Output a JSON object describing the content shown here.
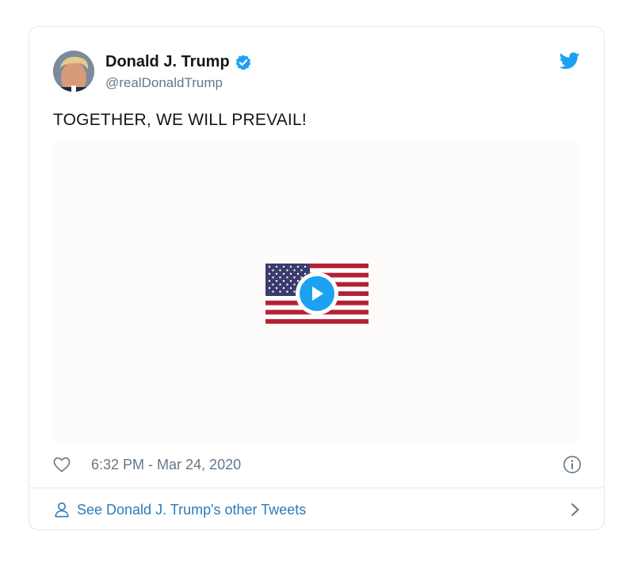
{
  "tweet": {
    "author_name": "Donald J. Trump",
    "handle": "@realDonaldTrump",
    "text": "TOGETHER, WE WILL PREVAIL!",
    "timestamp": "6:32 PM - Mar 24, 2020",
    "verified": true
  },
  "media": {
    "type": "video",
    "thumbnail": "american-flag"
  },
  "footer": {
    "see_more_label": "See Donald J. Trump's other Tweets"
  },
  "icons": {
    "brand": "twitter-bird-icon",
    "like": "heart-icon",
    "info": "info-icon",
    "profile": "person-icon",
    "next": "chevron-right-icon",
    "verified": "verified-badge-icon",
    "play": "play-icon"
  },
  "colors": {
    "twitter_blue": "#1da1f2",
    "link_blue": "#2b7bb9",
    "text_primary": "#14171a",
    "text_secondary": "#657786",
    "border": "#e1e8ed",
    "flag_red": "#b22234",
    "flag_blue": "#3c3b6e"
  }
}
